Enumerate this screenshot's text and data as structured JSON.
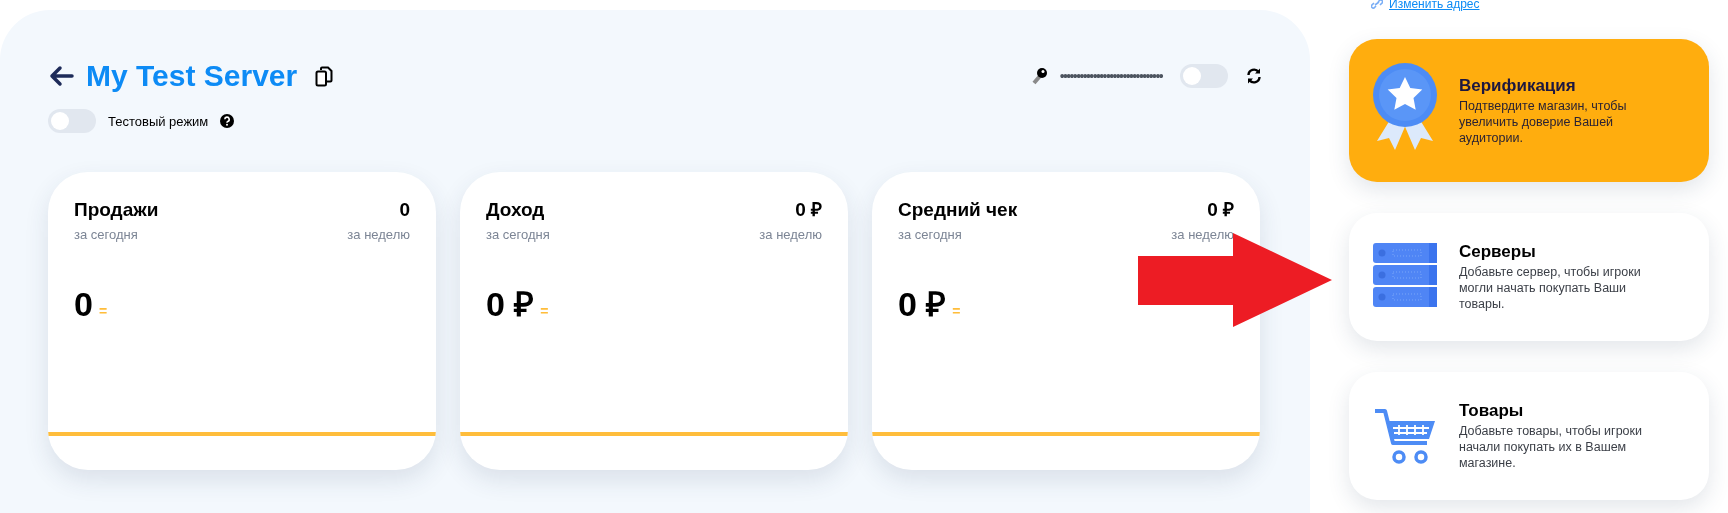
{
  "header": {
    "title": "My Test Server",
    "test_mode": {
      "label": "Тестовый режим",
      "on": false
    },
    "secret_key": {
      "masked_value": "•••••••••••••••••••••••••••••••",
      "visible": false
    }
  },
  "stats": [
    {
      "title": "Продажи",
      "week_value": "0",
      "week_label": "за неделю",
      "today_label": "за сегодня",
      "today_value": "0",
      "trend": "="
    },
    {
      "title": "Доход",
      "week_value": "0 ₽",
      "week_label": "за неделю",
      "today_label": "за сегодня",
      "today_value": "0 ₽",
      "trend": "="
    },
    {
      "title": "Средний чек",
      "week_value": "0 ₽",
      "week_label": "за неделю",
      "today_label": "за сегодня",
      "today_value": "0 ₽",
      "trend": "="
    }
  ],
  "sidebar": {
    "change_address_link": "Изменить адрес",
    "cards": [
      {
        "kind": "verification",
        "title": "Верификация",
        "description": "Подтвердите магазин, чтобы увеличить доверие Вашей аудитории.",
        "highlighted": true
      },
      {
        "kind": "servers",
        "title": "Серверы",
        "description": "Добавьте сервер, чтобы игроки могли начать покупать Ваши товары.",
        "highlighted": false
      },
      {
        "kind": "goods",
        "title": "Товары",
        "description": "Добавьте товары, чтобы игроки начали покупать их в Вашем магазине.",
        "highlighted": false
      }
    ]
  }
}
